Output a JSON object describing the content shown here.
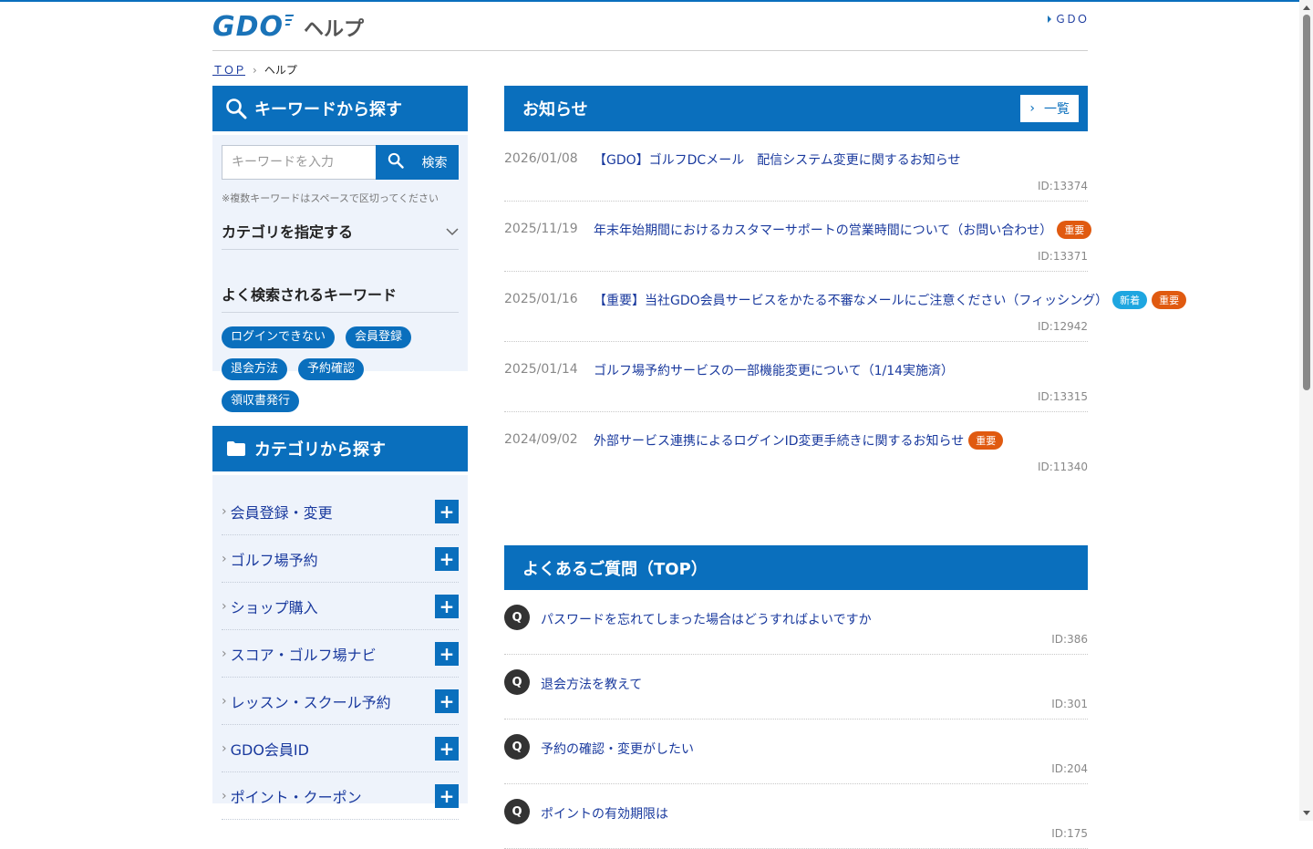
{
  "header": {
    "logo_text": "GDO",
    "logo_suffix": "ヘルプ",
    "top_link": "ＧＤＯ"
  },
  "breadcrumb": {
    "home": "ＴＯＰ",
    "current": "ヘルプ"
  },
  "search": {
    "title": "キーワードから探す",
    "placeholder": "キーワードを入力",
    "button_label": "検索",
    "note": "※複数キーワードはスペースで区切ってください",
    "accordion_label": "カテゴリを指定する",
    "keywords_title": "よく検索されるキーワード",
    "keywords": [
      "ログインできない",
      "会員登録",
      "退会方法",
      "予約確認",
      "領収書発行"
    ]
  },
  "categories": {
    "title": "カテゴリから探す",
    "items": [
      {
        "label": "会員登録・変更"
      },
      {
        "label": "ゴルフ場予約"
      },
      {
        "label": "ショップ購入"
      },
      {
        "label": "スコア・ゴルフ場ナビ"
      },
      {
        "label": "レッスン・スクール予約"
      },
      {
        "label": "GDO会員ID"
      },
      {
        "label": "ポイント・クーポン"
      }
    ]
  },
  "news": {
    "title": "お知らせ",
    "list_button": "一覧",
    "items": [
      {
        "date": "2026/01/08",
        "title": "【GDO】ゴルフDCメール　配信システム変更に関するお知らせ",
        "tags": [],
        "id": "ID:13374"
      },
      {
        "date": "2025/11/19",
        "title": "年末年始期間におけるカスタマーサポートの営業時間について（お問い合わせ）",
        "tags": [
          {
            "label": "重要",
            "color": "#e05a10"
          }
        ],
        "id": "ID:13371"
      },
      {
        "date": "2025/01/16",
        "title": "【重要】当社GDO会員サービスをかたる不審なメールにご注意ください（フィッシング）",
        "tags": [
          {
            "label": "新着",
            "color": "#1ea6e0"
          },
          {
            "label": "重要",
            "color": "#e05a10"
          }
        ],
        "id": "ID:12942"
      },
      {
        "date": "2025/01/14",
        "title": "ゴルフ場予約サービスの一部機能変更について（1/14実施済）",
        "tags": [],
        "id": "ID:13315"
      },
      {
        "date": "2024/09/02",
        "title": "外部サービス連携によるログインID変更手続きに関するお知らせ",
        "tags": [
          {
            "label": "重要",
            "color": "#e05a10"
          }
        ],
        "id": "ID:11340"
      }
    ]
  },
  "faq": {
    "title": "よくあるご質問（TOP）",
    "items": [
      {
        "q": "Q",
        "question": "パスワードを忘れてしまった場合はどうすればよいですか",
        "id": "ID:386"
      },
      {
        "q": "Q",
        "question": "退会方法を教えて",
        "id": "ID:301"
      },
      {
        "q": "Q",
        "question": "予約の確認・変更がしたい",
        "id": "ID:204"
      },
      {
        "q": "Q",
        "question": "ポイントの有効期限は",
        "id": "ID:175"
      }
    ]
  },
  "colors": {
    "brand": "#0a6fbd",
    "link": "#1a3a9e",
    "important_tag": "#e05a10",
    "new_tag": "#1ea6e0",
    "panel_bg": "#eef3fb"
  }
}
